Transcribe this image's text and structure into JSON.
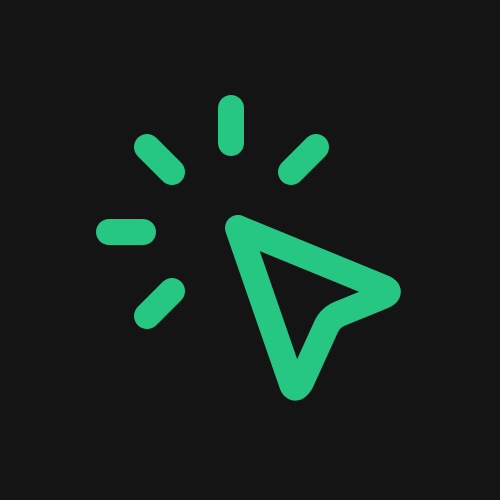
{
  "icon": {
    "name": "cursor-click-icon",
    "colors": {
      "background": "#141414",
      "accent": "#26C783"
    }
  }
}
